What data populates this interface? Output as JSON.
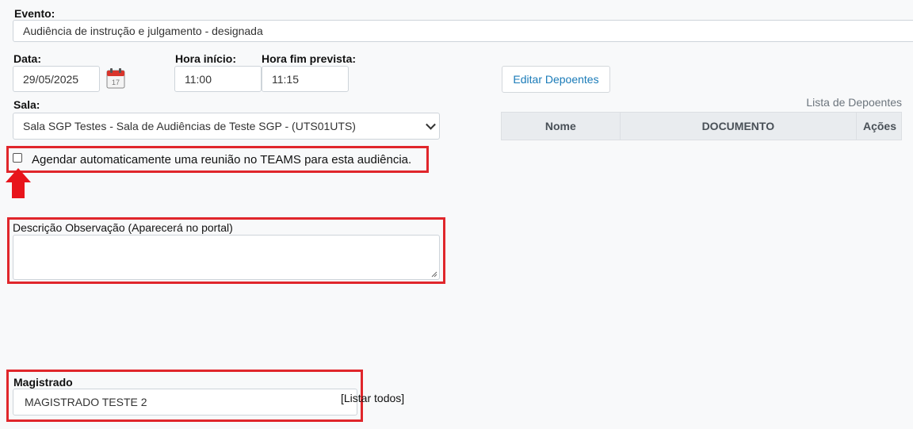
{
  "evento": {
    "label": "Evento:",
    "value": "Audiência de instrução e julgamento - designada"
  },
  "data": {
    "label": "Data:",
    "value": "29/05/2025",
    "icon": "calendar-icon",
    "icon_day": "17"
  },
  "hora_inicio": {
    "label": "Hora início:",
    "value": "11:00"
  },
  "hora_fim": {
    "label": "Hora fim prevista:",
    "value": "11:15"
  },
  "sala": {
    "label": "Sala:",
    "value": "Sala SGP Testes - Sala de Audiências de Teste SGP - (UTS01UTS)"
  },
  "teams": {
    "checked": false,
    "label": "Agendar automaticamente uma reunião no TEAMS para esta audiência."
  },
  "descricao": {
    "label": "Descrição Observação (Aparecerá no portal)",
    "value": ""
  },
  "magistrado": {
    "label": "Magistrado",
    "value": "MAGISTRADO TESTE 2",
    "list_all_link": "[Listar todos]"
  },
  "depoentes": {
    "edit_button": "Editar Depoentes",
    "caption": "Lista de Depoentes",
    "columns": [
      "Nome",
      "DOCUMENTO",
      "Ações"
    ]
  },
  "colors": {
    "highlight": "#e0262b",
    "link": "#1a7bb8",
    "background": "#f8f9fa"
  }
}
